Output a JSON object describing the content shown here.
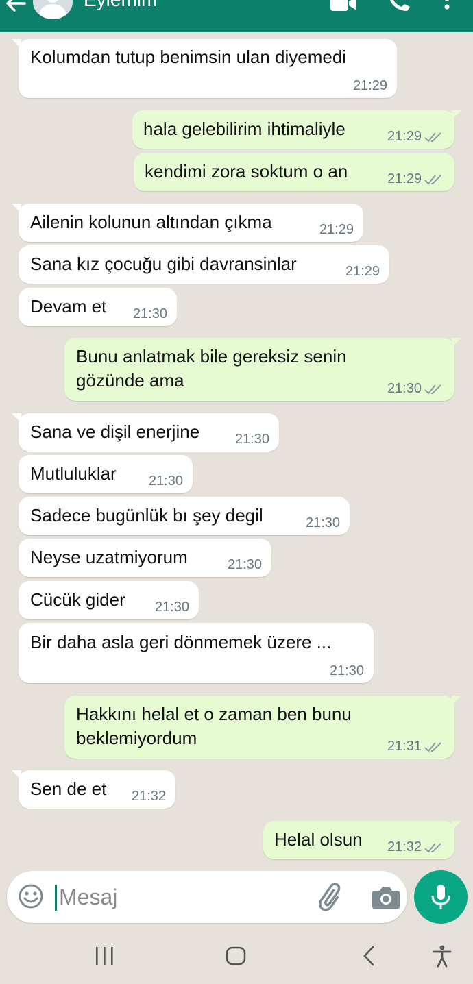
{
  "header": {
    "contact_name": "Eylemim",
    "back_icon": "arrow-left-icon",
    "video_icon": "video-call-icon",
    "call_icon": "phone-icon",
    "more_icon": "more-vert-icon",
    "color": "#0d806b"
  },
  "messages": [
    {
      "dir": "in",
      "text": "Kolumdan tutup benimsin ulan diyemedi",
      "time": "21:29"
    },
    {
      "dir": "out",
      "text": "hala gelebilirim ihtimaliyle",
      "time": "21:29",
      "read": true
    },
    {
      "dir": "out",
      "text": "kendimi zora soktum o an",
      "time": "21:29",
      "read": true
    },
    {
      "dir": "in",
      "text": "Ailenin kolunun altından çıkma",
      "time": "21:29"
    },
    {
      "dir": "in",
      "text": "Sana kız çocuğu gibi davransinlar",
      "time": "21:29"
    },
    {
      "dir": "in",
      "text": "Devam et",
      "time": "21:30"
    },
    {
      "dir": "out",
      "lines": [
        "Bunu anlatmak bile gereksiz senin",
        "gözünde ama"
      ],
      "time": "21:30",
      "read": true
    },
    {
      "dir": "in",
      "text": "Sana ve dişil enerjine",
      "time": "21:30"
    },
    {
      "dir": "in",
      "text": "Mutluluklar",
      "time": "21:30"
    },
    {
      "dir": "in",
      "text": "Sadece bugünlük bı şey degil",
      "time": "21:30"
    },
    {
      "dir": "in",
      "text": "Neyse uzatmiyorum",
      "time": "21:30"
    },
    {
      "dir": "in",
      "text": "Cücük gider",
      "time": "21:30"
    },
    {
      "dir": "in",
      "text": "Bir daha asla geri dönmemek üzere ...",
      "time": "21:30"
    },
    {
      "dir": "out",
      "lines": [
        "Hakkını helal et o zaman ben bunu",
        "beklemiyordum"
      ],
      "time": "21:31",
      "read": true
    },
    {
      "dir": "in",
      "text": "Sen de et",
      "time": "21:32"
    },
    {
      "dir": "out",
      "text": "Helal olsun",
      "time": "21:32",
      "read": true
    }
  ],
  "composer": {
    "placeholder": "Mesaj",
    "emoji_icon": "emoji-icon",
    "attach_icon": "paperclip-icon",
    "camera_icon": "camera-icon",
    "mic_icon": "microphone-icon",
    "mic_color": "#0aa786"
  },
  "navbar": {
    "icons": [
      "recent-apps-icon",
      "home-icon",
      "back-icon",
      "accessibility-icon"
    ]
  },
  "colors": {
    "chat_background": "#e6e1da",
    "outgoing_bubble": "#e7fbd3",
    "incoming_bubble": "#ffffff",
    "read_ticks": "#8a9ba5"
  }
}
